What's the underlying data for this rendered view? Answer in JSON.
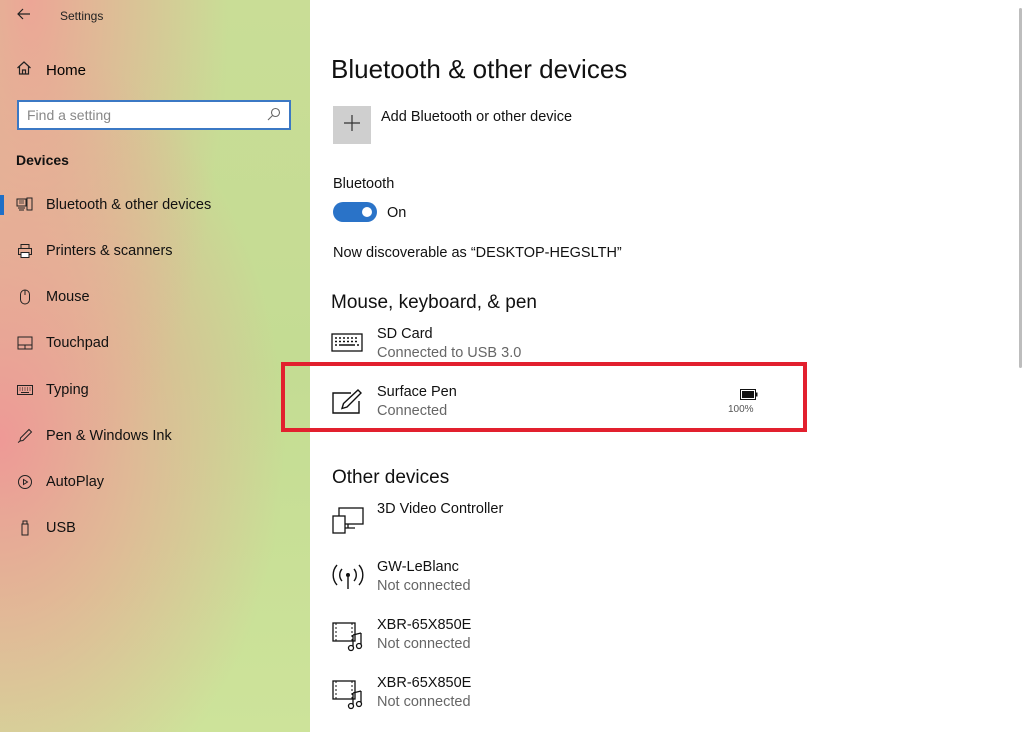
{
  "window": {
    "title": "Settings"
  },
  "sidebar": {
    "home_label": "Home",
    "search_placeholder": "Find a setting",
    "section_title": "Devices",
    "items": [
      {
        "label": "Bluetooth & other devices",
        "icon": "bluetooth-devices-icon",
        "active": true
      },
      {
        "label": "Printers & scanners",
        "icon": "printer-icon",
        "active": false
      },
      {
        "label": "Mouse",
        "icon": "mouse-icon",
        "active": false
      },
      {
        "label": "Touchpad",
        "icon": "touchpad-icon",
        "active": false
      },
      {
        "label": "Typing",
        "icon": "keyboard-icon",
        "active": false
      },
      {
        "label": "Pen & Windows Ink",
        "icon": "pen-icon",
        "active": false
      },
      {
        "label": "AutoPlay",
        "icon": "autoplay-icon",
        "active": false
      },
      {
        "label": "USB",
        "icon": "usb-icon",
        "active": false
      }
    ]
  },
  "main": {
    "title": "Bluetooth & other devices",
    "add_device_label": "Add Bluetooth or other device",
    "bluetooth_label": "Bluetooth",
    "bluetooth_state": "On",
    "discoverable_text": "Now discoverable as “DESKTOP-HEGSLTH”",
    "mouse_section_title": "Mouse, keyboard, & pen",
    "mouse_devices": [
      {
        "name": "SD Card",
        "status": "Connected to USB 3.0",
        "icon": "keyboard-icon"
      },
      {
        "name": "Surface Pen",
        "status": "Connected",
        "icon": "pen-tablet-icon",
        "battery": "100%"
      }
    ],
    "other_section_title": "Other devices",
    "other_devices": [
      {
        "name": "3D Video Controller",
        "status": "",
        "icon": "display-device-icon"
      },
      {
        "name": "GW-LeBlanc",
        "status": "Not connected",
        "icon": "wireless-icon"
      },
      {
        "name": "XBR-65X850E",
        "status": "Not connected",
        "icon": "media-device-icon"
      },
      {
        "name": "XBR-65X850E",
        "status": "Not connected",
        "icon": "media-device-icon"
      }
    ]
  },
  "colors": {
    "accent": "#2a73c8",
    "highlight": "#e2202e"
  }
}
